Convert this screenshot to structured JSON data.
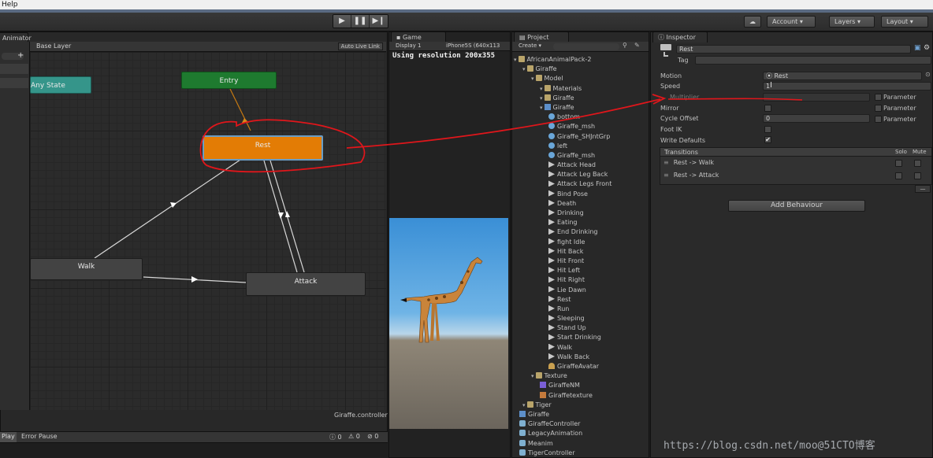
{
  "menu": {
    "help": "Help"
  },
  "toolbar": {
    "play_icon": "▶",
    "pause_icon": "❚❚",
    "step_icon": "▶❙",
    "account": "Account ▾",
    "layers": "Layers ▾",
    "layout": "Layout ▾"
  },
  "animator": {
    "tab": "Animator",
    "layer": "Base Layer",
    "auto_live_link": "Auto Live Link",
    "footer": "Giraffe.controller",
    "states": {
      "any": "Any State",
      "entry": "Entry",
      "rest": "Rest",
      "walk": "Walk",
      "attack": "Attack"
    }
  },
  "console": {
    "play": "Play",
    "error_pause": "Error Pause",
    "count_info": "0",
    "count_warn": "0",
    "count_error": "0"
  },
  "game": {
    "tab": "Game",
    "display": "Display 1",
    "device": "iPhone5S (640x113",
    "resolution": "Using resolution 200x355"
  },
  "project": {
    "tab": "Project",
    "create": "Create ▾",
    "search_placeholder": "",
    "tree": [
      {
        "label": "AfricanAnimalPack-2",
        "indent": 0,
        "icon": "folder-icon"
      },
      {
        "label": "Giraffe",
        "indent": 1,
        "icon": "folder-icon"
      },
      {
        "label": "Model",
        "indent": 2,
        "icon": "folder-icon"
      },
      {
        "label": "Materials",
        "indent": 3,
        "icon": "folder-icon"
      },
      {
        "label": "Giraffe",
        "indent": 3,
        "icon": "folder-icon"
      },
      {
        "label": "Giraffe",
        "indent": 3,
        "icon": "prefab-icon"
      },
      {
        "label": "bottom",
        "indent": 4,
        "icon": "mesh-icon"
      },
      {
        "label": "Giraffe_msh",
        "indent": 4,
        "icon": "mesh-icon"
      },
      {
        "label": "Giraffe_SHJntGrp",
        "indent": 4,
        "icon": "mesh-icon"
      },
      {
        "label": "left",
        "indent": 4,
        "icon": "mesh-icon"
      },
      {
        "label": "Giraffe_msh",
        "indent": 4,
        "icon": "mesh-icon"
      },
      {
        "label": "Attack Head",
        "indent": 4,
        "icon": "clip-icon"
      },
      {
        "label": "Attack Leg Back",
        "indent": 4,
        "icon": "clip-icon"
      },
      {
        "label": "Attack Legs Front",
        "indent": 4,
        "icon": "clip-icon"
      },
      {
        "label": "Bind Pose",
        "indent": 4,
        "icon": "clip-icon"
      },
      {
        "label": "Death",
        "indent": 4,
        "icon": "clip-icon"
      },
      {
        "label": "Drinking",
        "indent": 4,
        "icon": "clip-icon"
      },
      {
        "label": "Eating",
        "indent": 4,
        "icon": "clip-icon"
      },
      {
        "label": "End Drinking",
        "indent": 4,
        "icon": "clip-icon"
      },
      {
        "label": "fight Idle",
        "indent": 4,
        "icon": "clip-icon"
      },
      {
        "label": "Hit Back",
        "indent": 4,
        "icon": "clip-icon"
      },
      {
        "label": "Hit Front",
        "indent": 4,
        "icon": "clip-icon"
      },
      {
        "label": "Hit Left",
        "indent": 4,
        "icon": "clip-icon"
      },
      {
        "label": "Hit Right",
        "indent": 4,
        "icon": "clip-icon"
      },
      {
        "label": "Lie Dawn",
        "indent": 4,
        "icon": "clip-icon"
      },
      {
        "label": "Rest",
        "indent": 4,
        "icon": "clip-icon"
      },
      {
        "label": "Run",
        "indent": 4,
        "icon": "clip-icon"
      },
      {
        "label": "Sleeping",
        "indent": 4,
        "icon": "clip-icon"
      },
      {
        "label": "Stand Up",
        "indent": 4,
        "icon": "clip-icon"
      },
      {
        "label": "Start Drinking",
        "indent": 4,
        "icon": "clip-icon"
      },
      {
        "label": "Walk",
        "indent": 4,
        "icon": "clip-icon"
      },
      {
        "label": "Walk Back",
        "indent": 4,
        "icon": "clip-icon"
      },
      {
        "label": "GiraffeAvatar",
        "indent": 4,
        "icon": "avatar-icon"
      },
      {
        "label": "Texture",
        "indent": 2,
        "icon": "folder-icon"
      },
      {
        "label": "GiraffeNM",
        "indent": 3,
        "icon": "texture-nm-icon"
      },
      {
        "label": "Giraffetexture",
        "indent": 3,
        "icon": "texture-icon"
      },
      {
        "label": "Tiger",
        "indent": 1,
        "icon": "folder-icon"
      },
      {
        "label": "Giraffe",
        "indent": 0,
        "icon": "prefab-icon"
      },
      {
        "label": "GiraffeController",
        "indent": 0,
        "icon": "controller-icon"
      },
      {
        "label": "LegacyAnimation",
        "indent": 0,
        "icon": "controller-icon"
      },
      {
        "label": "Meanim",
        "indent": 0,
        "icon": "controller-icon"
      },
      {
        "label": "TigerController",
        "indent": 0,
        "icon": "controller-icon"
      }
    ]
  },
  "inspector": {
    "tab": "Inspector",
    "name": "Rest",
    "tag_label": "Tag",
    "motion_label": "Motion",
    "motion_value": "⦿ Rest",
    "speed_label": "Speed",
    "speed_value": "1",
    "multiplier_label": "Multiplier",
    "mirror_label": "Mirror",
    "cycle_offset_label": "Cycle Offset",
    "cycle_offset_value": "0",
    "foot_ik_label": "Foot IK",
    "write_defaults_label": "Write Defaults",
    "write_defaults_check": "✔",
    "parameter_label": "Parameter",
    "transitions_header": "Transitions",
    "solo_label": "Solo",
    "mute_label": "Mute",
    "transitions": [
      {
        "label": "Rest -> Walk"
      },
      {
        "label": "Rest -> Attack"
      }
    ],
    "remove_label": "—",
    "add_behaviour": "Add Behaviour"
  },
  "watermark": "https://blog.csdn.net/moo@51CTO博客",
  "colors": {
    "rest_state": "#e37c05",
    "entry_state": "#1e7a2f",
    "any_state": "#35958a",
    "default_state": "#434343",
    "annotation": "#e0161b"
  }
}
